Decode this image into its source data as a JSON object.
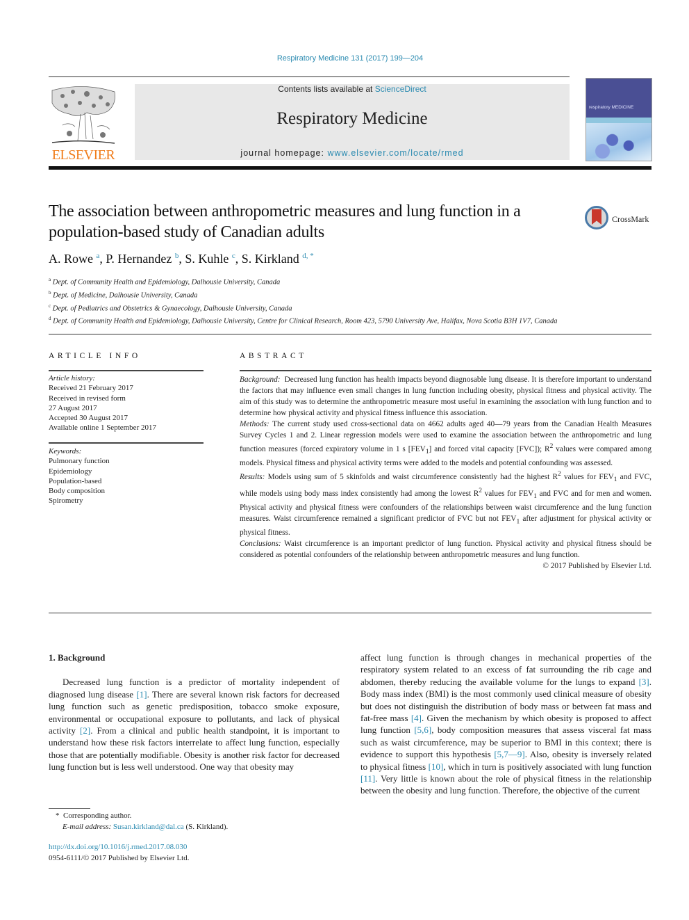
{
  "header": {
    "journal_ref": "Respiratory Medicine 131 (2017) 199—204",
    "contents_prefix": "Contents lists available at ",
    "contents_link": "ScienceDirect",
    "journal_name": "Respiratory Medicine",
    "homepage_prefix": "journal homepage: ",
    "homepage_link": "www.elsevier.com/locate/rmed",
    "publisher_logo_text": "ELSEVIER",
    "cover_title": "respiratory MEDICINE",
    "colors": {
      "link": "#2a8ab0",
      "elsevier_orange": "#f07c1a"
    }
  },
  "article": {
    "title": "The association between anthropometric measures and lung function in a population-based study of Canadian adults",
    "crossmark_label": "CrossMark",
    "authors": [
      {
        "name": "A. Rowe",
        "sup": "a"
      },
      {
        "name": "P. Hernandez",
        "sup": "b"
      },
      {
        "name": "S. Kuhle",
        "sup": "c"
      },
      {
        "name": "S. Kirkland",
        "sup": "d, *"
      }
    ],
    "affiliations": [
      {
        "sup": "a",
        "text": "Dept. of Community Health and Epidemiology, Dalhousie University, Canada"
      },
      {
        "sup": "b",
        "text": "Dept. of Medicine, Dalhousie University, Canada"
      },
      {
        "sup": "c",
        "text": "Dept. of Pediatrics and Obstetrics & Gynaecology, Dalhousie University, Canada"
      },
      {
        "sup": "d",
        "text": "Dept. of Community Health and Epidemiology, Dalhousie University, Centre for Clinical Research, Room 423, 5790 University Ave, Halifax, Nova Scotia B3H 1V7, Canada"
      }
    ]
  },
  "article_info": {
    "heading": "ARTICLE INFO",
    "history_label": "Article history:",
    "history": [
      "Received 21 February 2017",
      "Received in revised form",
      "27 August 2017",
      "Accepted 30 August 2017",
      "Available online 1 September 2017"
    ],
    "keywords_label": "Keywords:",
    "keywords": [
      "Pulmonary function",
      "Epidemiology",
      "Population-based",
      "Body composition",
      "Spirometry"
    ]
  },
  "abstract": {
    "heading": "ABSTRACT",
    "background_label": "Background:",
    "background": "Decreased lung function has health impacts beyond diagnosable lung disease. It is therefore important to understand the factors that may influence even small changes in lung function including obesity, physical fitness and physical activity. The aim of this study was to determine the anthropometric measure most useful in examining the association with lung function and to determine how physical activity and physical fitness influence this association.",
    "methods_label": "Methods:",
    "methods_1": "The current study used cross-sectional data on 4662 adults aged 40—79 years from the Canadian Health Measures Survey Cycles 1 and 2. Linear regression models were used to examine the association between the anthropometric and lung function measures (forced expiratory volume in 1 s [FEV",
    "methods_2": "] and forced vital capacity [FVC]); R",
    "methods_3": " values were compared among models. Physical fitness and physical activity terms were added to the models and potential confounding was assessed.",
    "results_label": "Results:",
    "results_1": "Models using sum of 5 skinfolds and waist circumference consistently had the highest R",
    "results_2": " values for FEV",
    "results_3": " and FVC, while models using body mass index consistently had among the lowest R",
    "results_4": " values for FEV",
    "results_5": " and FVC and for men and women. Physical activity and physical fitness were confounders of the relationships between waist circumference and the lung function measures. Waist circumference remained a significant predictor of FVC but not FEV",
    "results_6": " after adjustment for physical activity or physical fitness.",
    "conclusions_label": "Conclusions:",
    "conclusions": "Waist circumference is an important predictor of lung function. Physical activity and physical fitness should be considered as potential confounders of the relationship between anthropometric measures and lung function.",
    "copyright": "© 2017 Published by Elsevier Ltd.",
    "sub_1": "1",
    "sup_2": "2"
  },
  "body": {
    "section_heading": "1.  Background",
    "left_1": "Decreased lung function is a predictor of mortality independent of diagnosed lung disease ",
    "ref_1": "[1]",
    "left_2": ". There are several known risk factors for decreased lung function such as genetic predisposition, tobacco smoke exposure, environmental or occupational exposure to pollutants, and lack of physical activity ",
    "ref_2": "[2]",
    "left_3": ". From a clinical and public health standpoint, it is important to understand how these risk factors interrelate to affect lung function, especially those that are potentially modifiable. Obesity is another risk factor for decreased lung function but is less well understood. One way that obesity may",
    "right_1": "affect lung function is through changes in mechanical properties of the respiratory system related to an excess of fat surrounding the rib cage and abdomen, thereby reducing the available volume for the lungs to expand ",
    "ref_3": "[3]",
    "right_2": ". Body mass index (BMI) is the most commonly used clinical measure of obesity but does not distinguish the distribution of body mass or between fat mass and fat-free mass ",
    "ref_4": "[4]",
    "right_3": ". Given the mechanism by which obesity is proposed to affect lung function ",
    "ref_5": "[5,6]",
    "right_4": ", body composition measures that assess visceral fat mass such as waist circumference, may be superior to BMI in this context; there is evidence to support this hypothesis ",
    "ref_6": "[5,7—9]",
    "right_5": ". Also, obesity is inversely related to physical fitness ",
    "ref_7": "[10]",
    "right_6": ", which in turn is positively associated with lung function ",
    "ref_8": "[11]",
    "right_7": ". Very little is known about the role of physical fitness in the relationship between the obesity and lung function. Therefore, the objective of the current"
  },
  "footnotes": {
    "star": "*",
    "corresponding": "Corresponding author.",
    "email_label": "E-mail address:",
    "email": "Susan.kirkland@dal.ca",
    "email_suffix": " (S. Kirkland).",
    "doi": "http://dx.doi.org/10.1016/j.rmed.2017.08.030",
    "issn": "0954-6111/© 2017 Published by Elsevier Ltd."
  }
}
